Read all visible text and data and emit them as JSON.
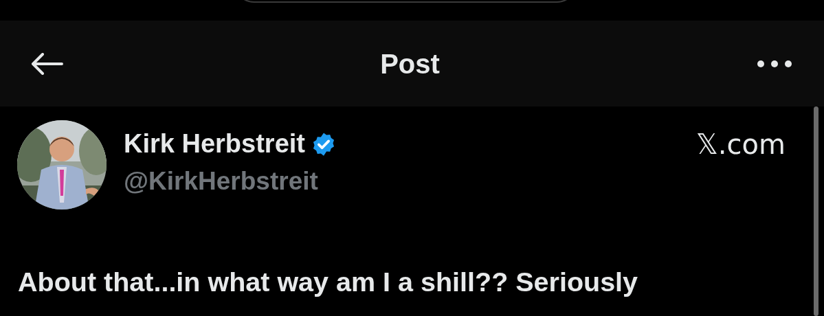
{
  "header": {
    "title": "Post"
  },
  "post": {
    "author": {
      "name": "Kirk Herbstreit",
      "verified": true,
      "handle": "@KirkHerbstreit"
    },
    "source": "𝕏.com",
    "text": "About that...in what way am I a shill?? Seriously"
  }
}
